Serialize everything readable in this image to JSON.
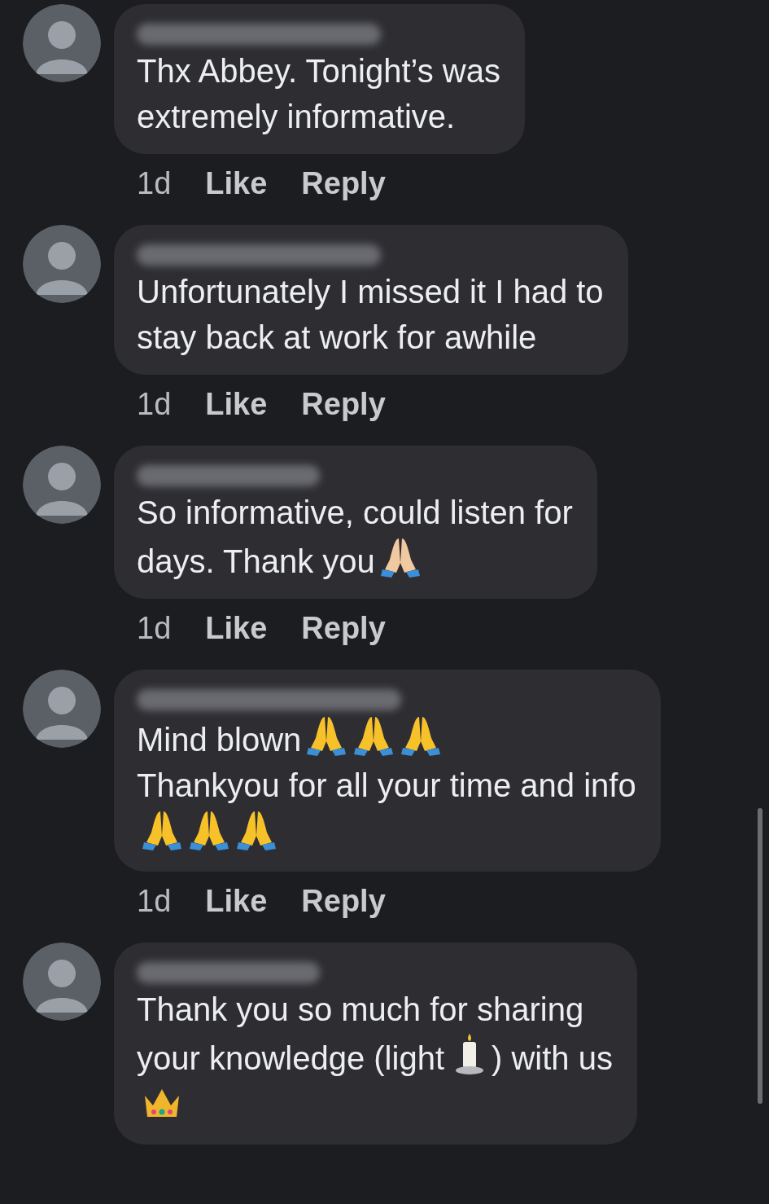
{
  "comments": [
    {
      "parts": [
        {
          "kind": "text",
          "text": "Thx Abbey. Tonight’s was"
        },
        {
          "kind": "break"
        },
        {
          "kind": "text",
          "text": "extremely informative."
        }
      ],
      "time": "1d",
      "like": "Like",
      "reply": "Reply"
    },
    {
      "parts": [
        {
          "kind": "text",
          "text": "Unfortunately I missed it I had to"
        },
        {
          "kind": "break"
        },
        {
          "kind": "text",
          "text": "stay back at work for awhile"
        }
      ],
      "time": "1d",
      "like": "Like",
      "reply": "Reply"
    },
    {
      "parts": [
        {
          "kind": "text",
          "text": "So informative, could listen for"
        },
        {
          "kind": "break"
        },
        {
          "kind": "text",
          "text": "days.  Thank you"
        },
        {
          "kind": "pray-light"
        }
      ],
      "time": "1d",
      "like": "Like",
      "reply": "Reply"
    },
    {
      "parts": [
        {
          "kind": "text",
          "text": "Mind blown"
        },
        {
          "kind": "pray"
        },
        {
          "kind": "pray"
        },
        {
          "kind": "pray"
        },
        {
          "kind": "break"
        },
        {
          "kind": "text",
          "text": "Thankyou for all your time and info"
        },
        {
          "kind": "break"
        },
        {
          "kind": "pray"
        },
        {
          "kind": "pray"
        },
        {
          "kind": "pray"
        }
      ],
      "time": "1d",
      "like": "Like",
      "reply": "Reply"
    },
    {
      "parts": [
        {
          "kind": "text",
          "text": "Thank you so much for sharing"
        },
        {
          "kind": "break"
        },
        {
          "kind": "text",
          "text": "your knowledge (light"
        },
        {
          "kind": "candle"
        },
        {
          "kind": "text",
          "text": ") with us"
        },
        {
          "kind": "break"
        },
        {
          "kind": "crown"
        }
      ]
    }
  ]
}
